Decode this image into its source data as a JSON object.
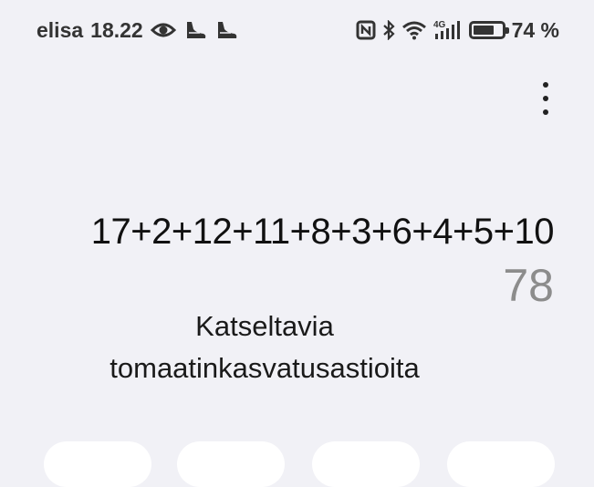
{
  "status_bar": {
    "carrier": "elisa",
    "time": "18.22",
    "network": "4G",
    "battery_percent": "74 %",
    "battery_level": 0.74,
    "icons": [
      "eye-icon",
      "shoe-icon",
      "shoe-icon",
      "nfc-icon",
      "bluetooth-icon",
      "wifi-icon",
      "signal-icon",
      "battery-icon"
    ]
  },
  "menu": {
    "icon": "more-vert-icon"
  },
  "calculator": {
    "expression": "17+2+12+11+8+3+6+4+5+10",
    "result": "78"
  },
  "overlay": {
    "line1": "Katseltavia",
    "line2": "tomaatinkasvatusastioita"
  }
}
